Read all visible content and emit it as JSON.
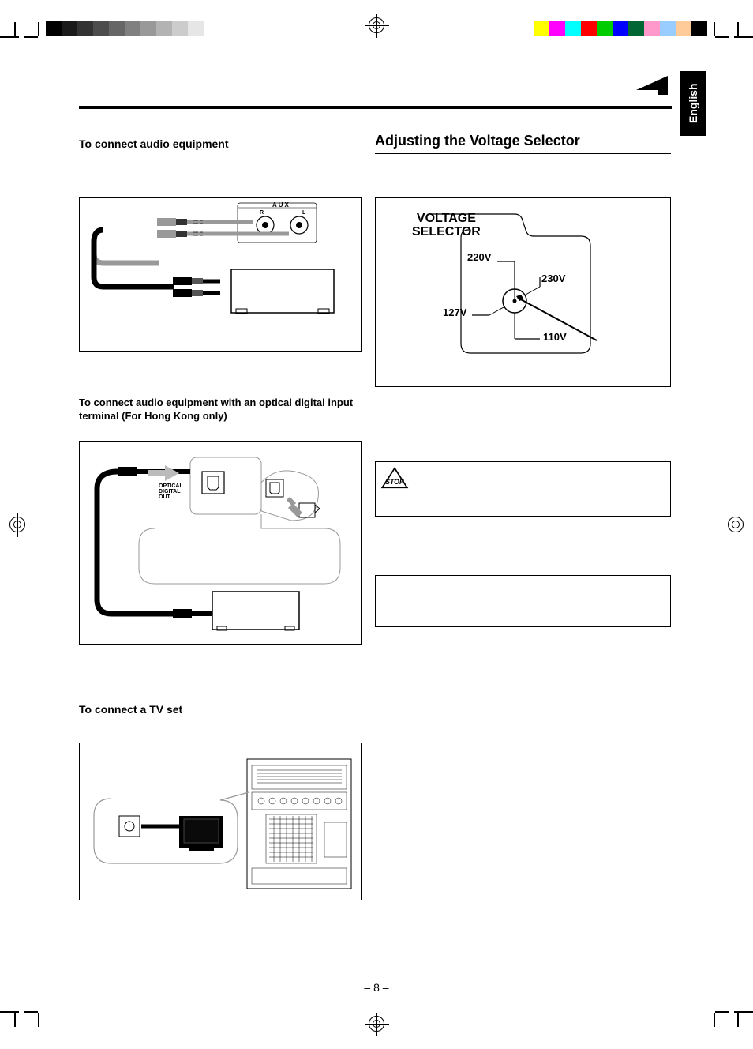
{
  "lang_tab": "English",
  "left_heading": "To connect audio equipment",
  "right_heading": "Adjusting the Voltage Selector",
  "fig1": {
    "aux": "AUX",
    "r": "R",
    "l": "L"
  },
  "fig2_label": "To connect audio equipment with an optical digital input terminal (For Hong Kong only)",
  "fig2": {
    "optical": "OPTICAL\nDIGITAL\nOUT"
  },
  "fig3_label": "To connect a TV set",
  "voltage": {
    "title_line1": "VOLTAGE",
    "title_line2": "SELECTOR",
    "v220": "220V",
    "v230": "230V",
    "v127": "127V",
    "v110": "110V"
  },
  "page_number": "– 8 –"
}
